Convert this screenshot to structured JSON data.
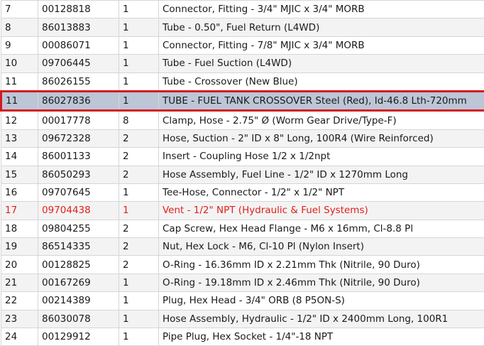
{
  "parts_table": {
    "selected_row_index": 5,
    "highlight_color": "#d41a1f",
    "warning_color": "#e0201c",
    "rows": [
      {
        "ref": "7",
        "part": "00128818",
        "qty": "1",
        "desc": "Connector, Fitting - 3/4\" MJIC x 3/4\" MORB",
        "status": "normal"
      },
      {
        "ref": "8",
        "part": "86013883",
        "qty": "1",
        "desc": "Tube - 0.50\", Fuel Return (L4WD)",
        "status": "normal"
      },
      {
        "ref": "9",
        "part": "00086071",
        "qty": "1",
        "desc": "Connector, Fitting - 7/8\" MJIC x 3/4\" MORB",
        "status": "normal"
      },
      {
        "ref": "10",
        "part": "09706445",
        "qty": "1",
        "desc": "Tube - Fuel Suction (L4WD)",
        "status": "normal"
      },
      {
        "ref": "11",
        "part": "86026155",
        "qty": "1",
        "desc": "Tube - Crossover (New Blue)",
        "status": "normal"
      },
      {
        "ref": "11",
        "part": "86027836",
        "qty": "1",
        "desc": "TUBE - FUEL TANK CROSSOVER Steel (Red), Id-46.8 Lth-720mm",
        "status": "selected"
      },
      {
        "ref": "12",
        "part": "00017778",
        "qty": "8",
        "desc": "Clamp, Hose - 2.75\" Ø (Worm Gear Drive/Type-F)",
        "status": "normal"
      },
      {
        "ref": "13",
        "part": "09672328",
        "qty": "2",
        "desc": "Hose, Suction - 2\" ID x 8\" Long, 100R4 (Wire Reinforced)",
        "status": "normal"
      },
      {
        "ref": "14",
        "part": "86001133",
        "qty": "2",
        "desc": "Insert - Coupling Hose 1/2 x 1/2npt",
        "status": "normal"
      },
      {
        "ref": "15",
        "part": "86050293",
        "qty": "2",
        "desc": "Hose Assembly, Fuel Line - 1/2\" ID x 1270mm Long",
        "status": "normal"
      },
      {
        "ref": "16",
        "part": "09707645",
        "qty": "1",
        "desc": "Tee-Hose, Connector - 1/2\" x 1/2\" NPT",
        "status": "normal"
      },
      {
        "ref": "17",
        "part": "09704438",
        "qty": "1",
        "desc": "Vent - 1/2\" NPT (Hydraulic & Fuel Systems)",
        "status": "warning"
      },
      {
        "ref": "18",
        "part": "09804255",
        "qty": "2",
        "desc": "Cap Screw, Hex Head Flange - M6 x 16mm, Cl-8.8 Pl",
        "status": "normal"
      },
      {
        "ref": "19",
        "part": "86514335",
        "qty": "2",
        "desc": "Nut, Hex Lock - M6, Cl-10 Pl (Nylon Insert)",
        "status": "normal"
      },
      {
        "ref": "20",
        "part": "00128825",
        "qty": "2",
        "desc": "O-Ring - 16.36mm ID x 2.21mm Thk (Nitrile, 90 Duro)",
        "status": "normal"
      },
      {
        "ref": "21",
        "part": "00167269",
        "qty": "1",
        "desc": "O-Ring - 19.18mm ID x 2.46mm Thk (Nitrile, 90 Duro)",
        "status": "normal"
      },
      {
        "ref": "22",
        "part": "00214389",
        "qty": "1",
        "desc": "Plug, Hex Head - 3/4\" ORB (8 P5ON-S)",
        "status": "normal"
      },
      {
        "ref": "23",
        "part": "86030078",
        "qty": "1",
        "desc": "Hose Assembly, Hydraulic - 1/2\" ID x 2400mm Long, 100R1",
        "status": "normal"
      },
      {
        "ref": "24",
        "part": "00129912",
        "qty": "1",
        "desc": "Pipe Plug, Hex Socket - 1/4\"-18 NPT",
        "status": "normal"
      }
    ]
  }
}
